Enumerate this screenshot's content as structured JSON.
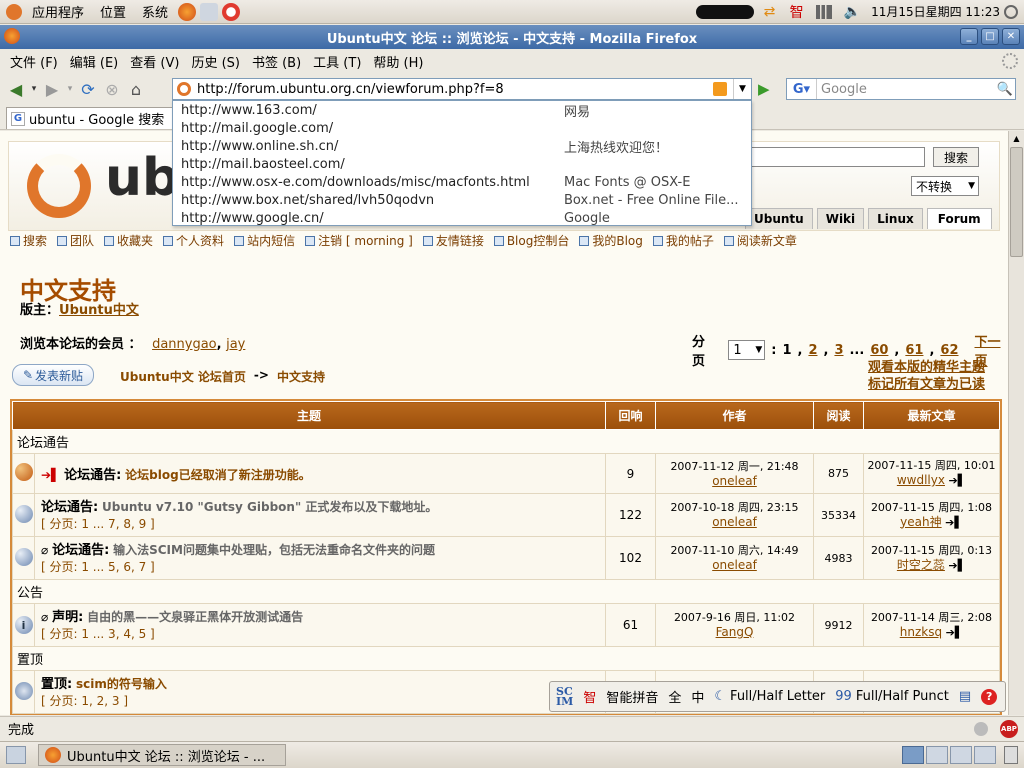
{
  "panel": {
    "menus": [
      "应用程序",
      "位置",
      "系统"
    ],
    "clock": "11月15日星期四 11:23"
  },
  "window": {
    "title": "Ubuntu中文 论坛 :: 浏览论坛 - 中文支持 - Mozilla Firefox"
  },
  "menubar": [
    "文件 (F)",
    "编辑 (E)",
    "查看 (V)",
    "历史 (S)",
    "书签 (B)",
    "工具 (T)",
    "帮助 (H)"
  ],
  "navbar": {
    "url": "http://forum.ubuntu.org.cn/viewforum.php?f=8",
    "search_placeholder": "Google"
  },
  "tab": {
    "label": "ubuntu - Google 搜索"
  },
  "dropdown": [
    {
      "url": "http://www.163.com/",
      "title": "网易"
    },
    {
      "url": "http://mail.google.com/",
      "title": ""
    },
    {
      "url": "http://www.online.sh.cn/",
      "title": "上海热线欢迎您！"
    },
    {
      "url": "http://mail.baosteel.com/",
      "title": ""
    },
    {
      "url": "http://www.osx-e.com/downloads/misc/macfonts.html",
      "title": "Mac Fonts @ OSX-E"
    },
    {
      "url": "http://www.box.net/shared/lvh50qodvn",
      "title": "Box.net - Free Online File..."
    },
    {
      "url": "http://www.google.cn/",
      "title": "Google"
    }
  ],
  "site": {
    "logo_text": "ubuntu",
    "search_btn": "搜索",
    "convert_select": "不转换",
    "tabs": [
      "Ubuntu",
      "Wiki",
      "Linux",
      "Forum"
    ],
    "toolbar": [
      "搜索",
      "团队",
      "收藏夹",
      "个人资料",
      "站内短信",
      "注销 [ morning ]",
      "友情链接",
      "Blog控制台",
      "我的Blog",
      "我的帖子",
      "阅读新文章"
    ]
  },
  "forum": {
    "title": "中文支持",
    "moderator_label": "版主：",
    "moderator": "Ubuntu中文",
    "viewers_label": "浏览本论坛的会员 ：",
    "viewers": [
      "dannygao",
      "jay"
    ],
    "pager_label": "分页",
    "pager_select": "1",
    "pager_items": [
      "1",
      "2",
      "3",
      "...",
      "60",
      "61",
      "62"
    ],
    "next_page": "下一页",
    "post_button": "发表新贴",
    "breadcrumb": [
      "Ubuntu中文  论坛首页",
      "->",
      "中文支持"
    ],
    "right_links": [
      "观看本版的精华主题",
      "标记所有文章为已读"
    ]
  },
  "table": {
    "headers": [
      "主题",
      "回响",
      "作者",
      "阅读",
      "最新文章"
    ],
    "sections": [
      {
        "name": "论坛通告",
        "rows": [
          {
            "prefix": "论坛通告:",
            "subject": "论坛blog已经取消了新注册功能。",
            "pages": "",
            "replies": "9",
            "author_date": "2007-11-12 周一, 21:48",
            "author": "oneleaf",
            "views": "875",
            "last_date": "2007-11-15 周四, 10:01",
            "last_user": "wwdllyx"
          },
          {
            "prefix": "论坛通告:",
            "subject": "Ubuntu v7.10 \"Gutsy Gibbon\" 正式发布以及下载地址。",
            "pages": "[ 分页: 1 ... 7, 8, 9 ]",
            "replies": "122",
            "author_date": "2007-10-18 周四, 23:15",
            "author": "oneleaf",
            "views": "35334",
            "last_date": "2007-11-15 周四, 1:08",
            "last_user": "yeah神"
          },
          {
            "prefix": "论坛通告:",
            "subject": "输入法SCIM问题集中处理贴，包括无法重命名文件夹的问题",
            "pages": "[ 分页: 1 ... 5, 6, 7 ]",
            "replies": "102",
            "author_date": "2007-11-10 周六, 14:49",
            "author": "oneleaf",
            "views": "4983",
            "last_date": "2007-11-15 周四, 0:13",
            "last_user": "时空之蕊"
          }
        ]
      },
      {
        "name": "公告",
        "rows": [
          {
            "prefix": "声明:",
            "subject": "自由的黑——文泉驿正黑体开放测试通告",
            "pages": "[ 分页: 1 ... 3, 4, 5 ]",
            "replies": "61",
            "author_date": "2007-9-16 周日, 11:02",
            "author": "FangQ",
            "views": "9912",
            "last_date": "2007-11-14 周三, 2:08",
            "last_user": "hnzksq"
          }
        ]
      },
      {
        "name": "置顶",
        "rows": [
          {
            "prefix": "置顶:",
            "subject": "scim的符号输入",
            "pages": "[ 分页: 1, 2, 3 ]",
            "replies": "",
            "author_date": "",
            "author": "",
            "views": "",
            "last_date": "",
            "last_user": ""
          }
        ]
      }
    ]
  },
  "status": "完成",
  "ime": {
    "name": "智能拼音",
    "full": "全",
    "mid": "中",
    "letter": "Full/Half Letter",
    "punct": "Full/Half Punct"
  },
  "taskbar": {
    "item": "Ubuntu中文 论坛 :: 浏览论坛 - ..."
  },
  "colors": {
    "accent": "#9c4f0b",
    "titlebar": "#3d6aa6"
  }
}
